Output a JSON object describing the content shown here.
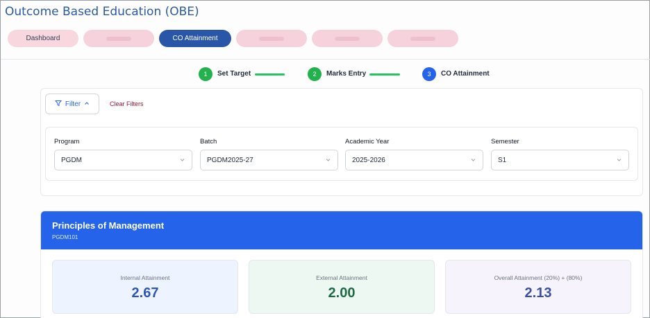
{
  "app": {
    "title": "Outcome Based Education (OBE)"
  },
  "tabs": [
    {
      "label": "Dashboard",
      "state": "inactive"
    },
    {
      "label": "",
      "state": "redacted"
    },
    {
      "label": "CO Attainment",
      "state": "active"
    },
    {
      "label": "",
      "state": "redacted"
    },
    {
      "label": "",
      "state": "redacted"
    },
    {
      "label": "",
      "state": "redacted"
    }
  ],
  "stepper": {
    "steps": [
      {
        "number": "1",
        "label": "Set Target",
        "status": "done"
      },
      {
        "number": "2",
        "label": "Marks Entry",
        "status": "done"
      },
      {
        "number": "3",
        "label": "CO Attainment",
        "status": "current"
      }
    ]
  },
  "filters": {
    "filter_button_label": "Filter",
    "clear_label": "Clear Filters",
    "fields": [
      {
        "label": "Program",
        "value": "PGDM"
      },
      {
        "label": "Batch",
        "value": "PGDM2025-27"
      },
      {
        "label": "Academic Year",
        "value": "2025-2026"
      },
      {
        "label": "Semester",
        "value": "S1"
      }
    ]
  },
  "course": {
    "title": "Principles of Management",
    "code": "PGDM101",
    "stats": [
      {
        "label": "Internal Attainment",
        "value": "2.67",
        "color": "#2f55b5",
        "bg": "#eef4ff"
      },
      {
        "label": "External Attainment",
        "value": "2.00",
        "color": "#1e6b45",
        "bg": "#ecf8f1"
      },
      {
        "label": "Overall Attainment (20%) + (80%)",
        "value": "2.13",
        "color": "#3b4ea1",
        "bg": "#f6f3fc"
      }
    ]
  },
  "colors": {
    "brand": "#2563eb",
    "tab_active": "#2a56a8",
    "tab_inactive": "#f8d7df",
    "step_done": "#22b14c"
  }
}
